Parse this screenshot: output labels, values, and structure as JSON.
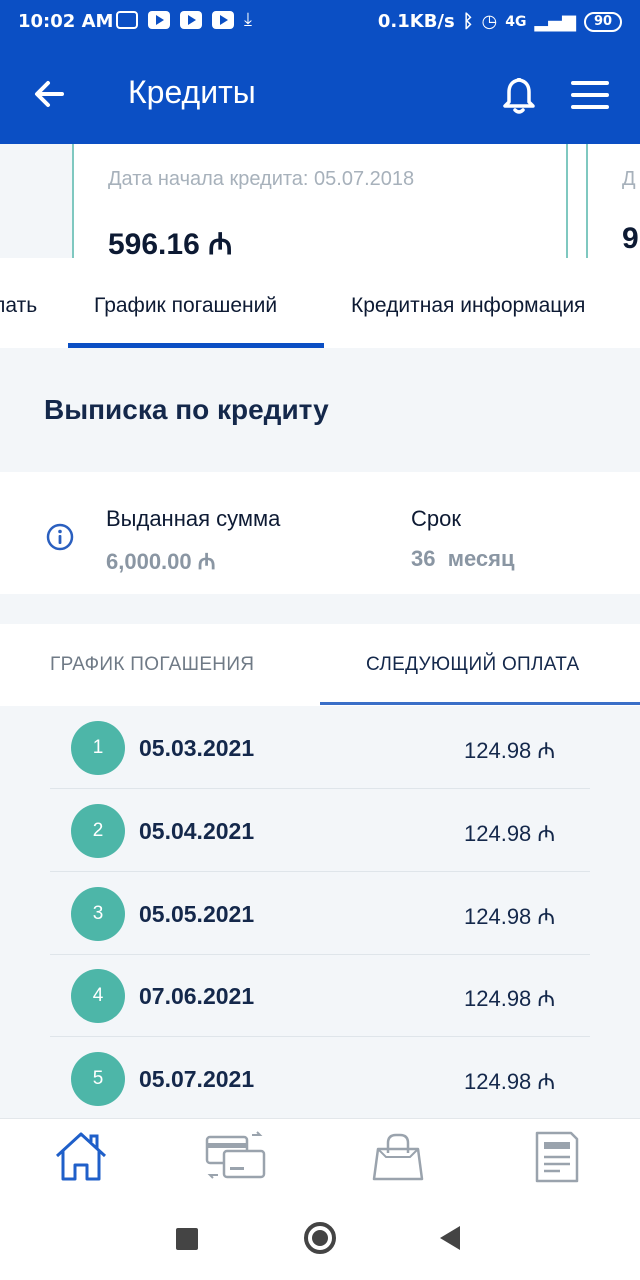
{
  "status_bar": {
    "time": "10:02 AM",
    "net_speed": "0.1KB/s",
    "network": "4G",
    "battery": "90"
  },
  "app_bar": {
    "title": "Кредиты"
  },
  "cards": {
    "start_date_label": "Дата начала кредита: 05.07.2018",
    "amount": "596.16 ₼",
    "next_label": "Д",
    "next_amount": "9"
  },
  "tabs": {
    "items": [
      {
        "label": "пать"
      },
      {
        "label": "График погашений"
      },
      {
        "label": "Кредитная информация"
      }
    ],
    "active_index": 1
  },
  "statement": {
    "title": "Выписка по кредиту"
  },
  "info": {
    "issued_label": "Выданная сумма",
    "issued_value": "6,000.00 ₼",
    "term_label": "Срок",
    "term_value": "36  месяц"
  },
  "subtabs": {
    "schedule": "ГРАФИК ПОГАШЕНИЯ",
    "next_payment": "СЛЕДУЮЩИЙ ОПЛАТА",
    "active": "next_payment"
  },
  "payments": [
    {
      "num": "1",
      "date": "05.03.2021",
      "amount": "124.98 ₼"
    },
    {
      "num": "2",
      "date": "05.04.2021",
      "amount": "124.98 ₼"
    },
    {
      "num": "3",
      "date": "05.05.2021",
      "amount": "124.98 ₼"
    },
    {
      "num": "4",
      "date": "07.06.2021",
      "amount": "124.98 ₼"
    },
    {
      "num": "5",
      "date": "05.07.2021",
      "amount": "124.98 ₼"
    }
  ],
  "colors": {
    "brand_blue": "#0b4fc4",
    "teal": "#4db6a8",
    "background_grey": "#f3f6f9"
  },
  "icons": {
    "app_bar": [
      "back-arrow-icon",
      "bell-icon",
      "menu-icon"
    ],
    "bottom_nav": [
      "home-icon",
      "cards-transfer-icon",
      "shopping-bag-icon",
      "document-icon"
    ]
  }
}
